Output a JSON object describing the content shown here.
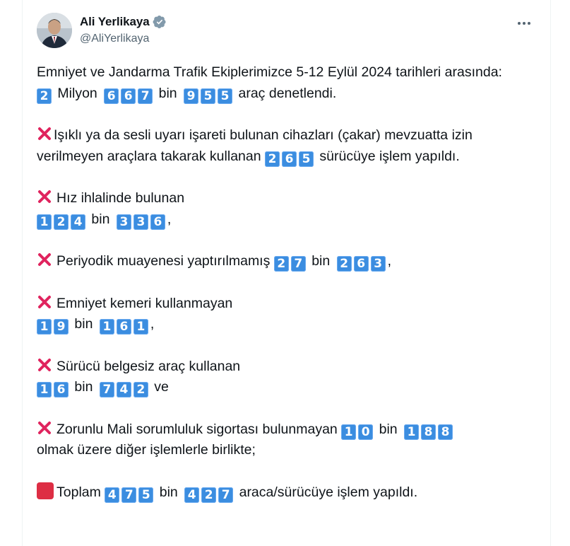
{
  "author": {
    "name": "Ali Yerlikaya",
    "handle": "@AliYerlikaya"
  },
  "icons": {
    "verified": "verified-badge-icon",
    "more": "more-options-icon",
    "cross": "cross-mark-emoji",
    "square": "red-square-emoji",
    "digits": "keycap-digit-emoji"
  },
  "colors": {
    "verified": "#1d9bf0",
    "keycap": "#3b8de0",
    "cross": "#e0245e",
    "square": "#dd2e44",
    "secondary_text": "#536471"
  },
  "tweet": {
    "intro": {
      "line1": "Emniyet ve Jandarma Trafik Ekiplerimizce 5-12 Eylül 2024 tarihleri arasında:",
      "total_checked": {
        "a": "2",
        "a_label": "Milyon",
        "b": "667",
        "b_label": "bin",
        "c": "955",
        "suffix": "araç denetlendi."
      }
    },
    "cakar": {
      "text1": "Işıklı ya da sesli uyarı işareti bulunan cihazları (çakar) mevzuatta izin verilmeyen araçlara takarak kullanan",
      "count": "265",
      "text2": "sürücüye işlem yapıldı."
    },
    "speed": {
      "label": "Hız ihlalinde bulunan",
      "a": "124",
      "mid": "bin",
      "b": "336",
      "end": ","
    },
    "inspection": {
      "label": "Periyodik muayenesi yaptırılmamış",
      "a": "27",
      "mid": "bin",
      "b": "263",
      "end": ","
    },
    "seatbelt": {
      "label": "Emniyet kemeri kullanmayan",
      "a": "19",
      "mid": "bin",
      "b": "161",
      "end": ","
    },
    "license": {
      "label": "Sürücü belgesiz araç kullanan",
      "a": "16",
      "mid": "bin",
      "b": "742",
      "end": "ve"
    },
    "insurance": {
      "label": "Zorunlu Mali sorumluluk sigortası bulunmayan",
      "a": "10",
      "mid": "bin",
      "b": "188",
      "line2": "olmak üzere diğer işlemlerle birlikte;"
    },
    "total": {
      "label": "Toplam",
      "a": "475",
      "mid": "bin",
      "b": "427",
      "suffix": "araca/sürücüye işlem yapıldı."
    }
  }
}
